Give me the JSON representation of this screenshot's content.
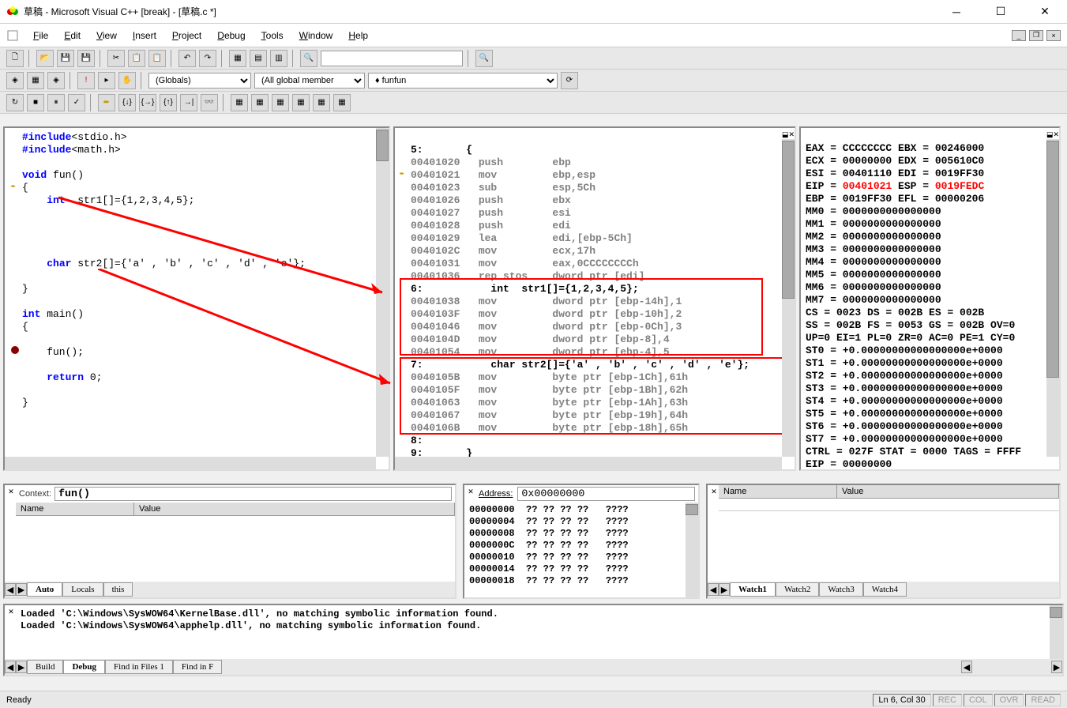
{
  "window": {
    "title": "草稿 - Microsoft Visual C++ [break] - [草稿.c *]"
  },
  "menu": {
    "file": "File",
    "edit": "Edit",
    "view": "View",
    "insert": "Insert",
    "project": "Project",
    "debug": "Debug",
    "tools": "Tools",
    "window": "Window",
    "help": "Help"
  },
  "toolbar2": {
    "scope": "(Globals)",
    "members": "(All global member",
    "func": "fun"
  },
  "source_lines": [
    {
      "t": "#include<stdio.h>",
      "cls": "kw-blue"
    },
    {
      "t": "#include<math.h>",
      "cls": "kw-blue"
    },
    {
      "t": "",
      "cls": ""
    },
    {
      "t": "void fun()",
      "cls": "kw-blue"
    },
    {
      "t": "{",
      "cls": "",
      "arrow": true
    },
    {
      "t": "    int  str1[]={1,2,3,4,5};",
      "cls": "kw-blue"
    },
    {
      "t": "",
      "cls": ""
    },
    {
      "t": "",
      "cls": ""
    },
    {
      "t": "",
      "cls": ""
    },
    {
      "t": "",
      "cls": ""
    },
    {
      "t": "    char str2[]={'a' , 'b' , 'c' , 'd' , 'e'};",
      "cls": "kw-blue"
    },
    {
      "t": "",
      "cls": ""
    },
    {
      "t": "}",
      "cls": ""
    },
    {
      "t": "",
      "cls": ""
    },
    {
      "t": "int main()",
      "cls": "kw-blue"
    },
    {
      "t": "{",
      "cls": ""
    },
    {
      "t": "",
      "cls": ""
    },
    {
      "t": "    fun();",
      "cls": "",
      "break": true
    },
    {
      "t": "",
      "cls": ""
    },
    {
      "t": "    return 0;",
      "cls": "kw-blue"
    },
    {
      "t": "",
      "cls": ""
    },
    {
      "t": "}",
      "cls": ""
    }
  ],
  "disasm_lines": [
    "5:       {",
    "00401020   push        ebp",
    "00401021   mov         ebp,esp",
    "00401023   sub         esp,5Ch",
    "00401026   push        ebx",
    "00401027   push        esi",
    "00401028   push        edi",
    "00401029   lea         edi,[ebp-5Ch]",
    "0040102C   mov         ecx,17h",
    "00401031   mov         eax,0CCCCCCCCh",
    "00401036   rep stos    dword ptr [edi]",
    "6:           int  str1[]={1,2,3,4,5};",
    "00401038   mov         dword ptr [ebp-14h],1",
    "0040103F   mov         dword ptr [ebp-10h],2",
    "00401046   mov         dword ptr [ebp-0Ch],3",
    "0040104D   mov         dword ptr [ebp-8],4",
    "00401054   mov         dword ptr [ebp-4],5",
    "7:           char str2[]={'a' , 'b' , 'c' , 'd' , 'e'};",
    "0040105B   mov         byte ptr [ebp-1Ch],61h",
    "0040105F   mov         byte ptr [ebp-1Bh],62h",
    "00401063   mov         byte ptr [ebp-1Ah],63h",
    "00401067   mov         byte ptr [ebp-19h],64h",
    "0040106B   mov         byte ptr [ebp-18h],65h",
    "8:",
    "9:       }"
  ],
  "disasm_arrow_line": 2,
  "registers": [
    "EAX = CCCCCCCC EBX = 00246000",
    "ECX = 00000000 EDX = 005610C0",
    "ESI = 00401110 EDI = 0019FF30",
    "EIP = |00401021| ESP = |0019FEDC|",
    "EBP = 0019FF30 EFL = 00000206",
    "MM0 = 0000000000000000",
    "MM1 = 0000000000000000",
    "MM2 = 0000000000000000",
    "MM3 = 0000000000000000",
    "MM4 = 0000000000000000",
    "MM5 = 0000000000000000",
    "MM6 = 0000000000000000",
    "MM7 = 0000000000000000",
    "CS = 0023 DS = 002B ES = 002B",
    "SS = 002B FS = 0053 GS = 002B OV=0",
    "UP=0 EI=1 PL=0 ZR=0 AC=0 PE=1 CY=0",
    "ST0 = +0.00000000000000000e+0000",
    "ST1 = +0.00000000000000000e+0000",
    "ST2 = +0.00000000000000000e+0000",
    "ST3 = +0.00000000000000000e+0000",
    "ST4 = +0.00000000000000000e+0000",
    "ST5 = +0.00000000000000000e+0000",
    "ST6 = +0.00000000000000000e+0000",
    "ST7 = +0.00000000000000000e+0000",
    "CTRL = 027F STAT = 0000 TAGS = FFFF",
    "EIP = 00000000"
  ],
  "context": {
    "label": "Context:",
    "value": "fun()"
  },
  "vars_header": {
    "name": "Name",
    "value": "Value"
  },
  "vars_tabs": [
    "Auto",
    "Locals",
    "this"
  ],
  "memory": {
    "label": "Address:",
    "value": "0x00000000",
    "lines": [
      "00000000  ?? ?? ?? ??   ????",
      "00000004  ?? ?? ?? ??   ????",
      "00000008  ?? ?? ?? ??   ????",
      "0000000C  ?? ?? ?? ??   ????",
      "00000010  ?? ?? ?? ??   ????",
      "00000014  ?? ?? ?? ??   ????",
      "00000018  ?? ?? ?? ??   ????"
    ]
  },
  "watch": {
    "header_name": "Name",
    "header_value": "Value",
    "tabs": [
      "Watch1",
      "Watch2",
      "Watch3",
      "Watch4"
    ]
  },
  "output": {
    "lines": [
      "Loaded 'C:\\Windows\\SysWOW64\\KernelBase.dll', no matching symbolic information found.",
      "Loaded 'C:\\Windows\\SysWOW64\\apphelp.dll', no matching symbolic information found."
    ],
    "tabs": [
      "Build",
      "Debug",
      "Find in Files 1",
      "Find in F"
    ]
  },
  "status": {
    "ready": "Ready",
    "pos": "Ln 6, Col 30",
    "indicators": [
      "REC",
      "COL",
      "OVR",
      "READ"
    ]
  }
}
